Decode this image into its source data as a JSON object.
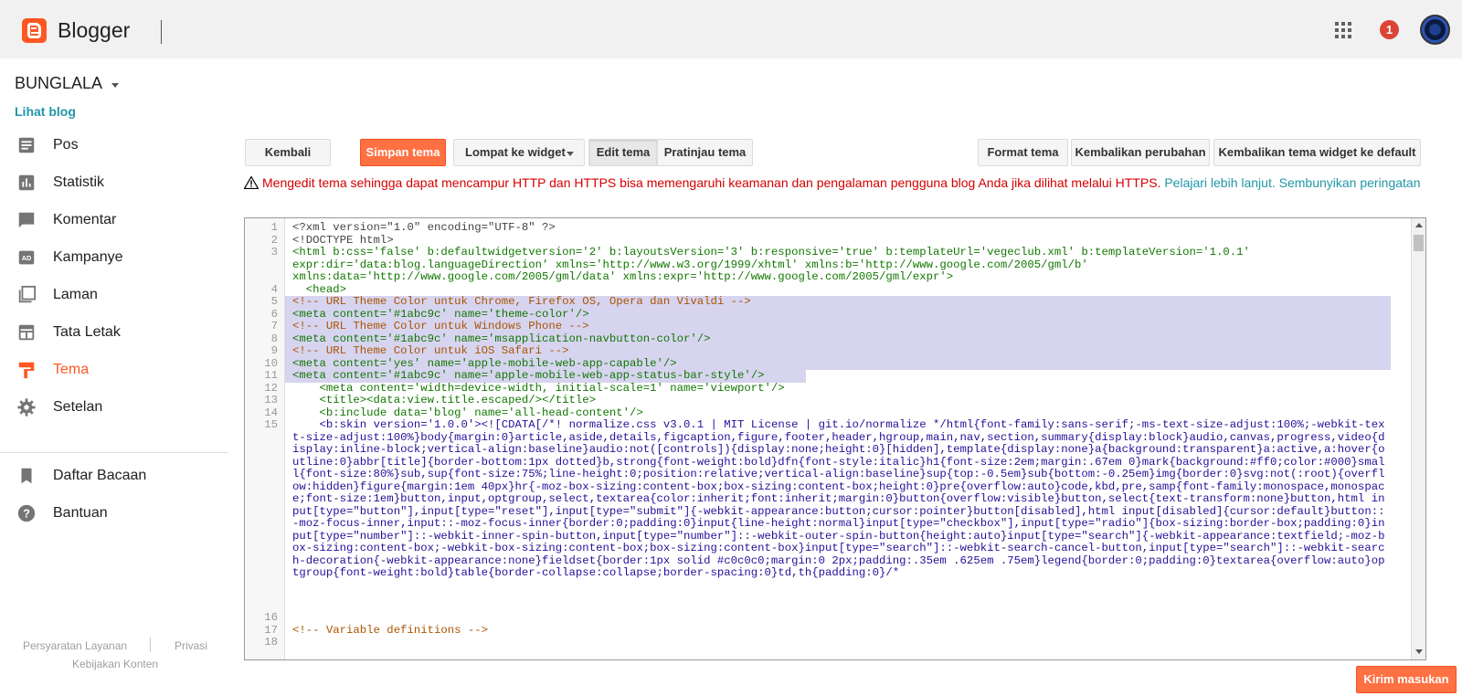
{
  "header": {
    "brand": "Blogger",
    "notification_count": "1"
  },
  "sidebar": {
    "blog_name": "BUNGLALA",
    "view_blog": "Lihat blog",
    "items": [
      {
        "label": "Pos",
        "icon": "posts-icon"
      },
      {
        "label": "Statistik",
        "icon": "stats-icon"
      },
      {
        "label": "Komentar",
        "icon": "comment-icon"
      },
      {
        "label": "Kampanye",
        "icon": "ads-icon"
      },
      {
        "label": "Laman",
        "icon": "pages-icon"
      },
      {
        "label": "Tata Letak",
        "icon": "layout-icon"
      },
      {
        "label": "Tema",
        "icon": "theme-icon",
        "active": true
      },
      {
        "label": "Setelan",
        "icon": "gear-icon"
      }
    ],
    "secondary": [
      {
        "label": "Daftar Bacaan",
        "icon": "bookmark-icon"
      },
      {
        "label": "Bantuan",
        "icon": "help-icon"
      }
    ],
    "footer": {
      "terms": "Persyaratan Layanan",
      "privacy": "Privasi",
      "content_policy": "Kebijakan Konten"
    }
  },
  "toolbar": {
    "back": "Kembali",
    "save": "Simpan tema",
    "jump_widget": "Lompat ke widget",
    "edit_theme": "Edit tema",
    "preview_theme": "Pratinjau tema",
    "format_theme": "Format tema",
    "revert_changes": "Kembalikan perubahan",
    "revert_widget": "Kembalikan tema widget ke default"
  },
  "warning": {
    "text": "Mengedit tema sehingga dapat mencampur HTTP dan HTTPS bisa memengaruhi keamanan dan pengalaman pengguna blog Anda jika dilihat melalui HTTPS.",
    "learn_more": "Pelajari lebih lanjut.",
    "hide": "Sembunyikan peringatan"
  },
  "editor": {
    "line_numbers": [
      "1",
      "2",
      "3",
      "4",
      "5",
      "6",
      "7",
      "8",
      "9",
      "10",
      "11",
      "12",
      "13",
      "14",
      "15",
      "16",
      "17",
      "18"
    ],
    "lines": {
      "l1": "<?xml version=\"1.0\" encoding=\"UTF-8\" ?>",
      "l2": "<!DOCTYPE html>",
      "l3a": "<html b:css='false' b:defaultwidgetversion='2' b:layoutsVersion='3' b:responsive='true' b:templateUrl='vegeclub.xml' b:templateVersion='1.0.1'",
      "l3b": "expr:dir='data:blog.languageDirection' xmlns='http://www.w3.org/1999/xhtml' xmlns:b='http://www.google.com/2005/gml/b'",
      "l3c": "xmlns:data='http://www.google.com/2005/gml/data' xmlns:expr='http://www.google.com/2005/gml/expr'>",
      "l4": "  <head>",
      "l5": "<!-- URL Theme Color untuk Chrome, Firefox OS, Opera dan Vivaldi -->",
      "l6": "<meta content='#1abc9c' name='theme-color'/>",
      "l7": "<!-- URL Theme Color untuk Windows Phone -->",
      "l8": "<meta content='#1abc9c' name='msapplication-navbutton-color'/>",
      "l9": "<!-- URL Theme Color untuk iOS Safari -->",
      "l10": "<meta content='yes' name='apple-mobile-web-app-capable'/>",
      "l11": "<meta content='#1abc9c' name='apple-mobile-web-app-status-bar-style'/>",
      "l12": "    <meta content='width=device-width, initial-scale=1' name='viewport'/>",
      "l13": "    <title><data:view.title.escaped/></title>",
      "l14": "    <b:include data='blog' name='all-head-content'/>",
      "l15": "    <b:skin version='1.0.0'><![CDATA[/*! normalize.css v3.0.1 | MIT License | git.io/normalize */html{font-family:sans-serif;-ms-text-size-adjust:100%;-webkit-text-size-adjust:100%}body{margin:0}article,aside,details,figcaption,figure,footer,header,hgroup,main,nav,section,summary{display:block}audio,canvas,progress,video{display:inline-block;vertical-align:baseline}audio:not([controls]){display:none;height:0}[hidden],template{display:none}a{background:transparent}a:active,a:hover{outline:0}abbr[title]{border-bottom:1px dotted}b,strong{font-weight:bold}dfn{font-style:italic}h1{font-size:2em;margin:.67em 0}mark{background:#ff0;color:#000}small{font-size:80%}sub,sup{font-size:75%;line-height:0;position:relative;vertical-align:baseline}sup{top:-0.5em}sub{bottom:-0.25em}img{border:0}svg:not(:root){overflow:hidden}figure{margin:1em 40px}hr{-moz-box-sizing:content-box;box-sizing:content-box;height:0}pre{overflow:auto}code,kbd,pre,samp{font-family:monospace,monospace;font-size:1em}button,input,optgroup,select,textarea{color:inherit;font:inherit;margin:0}button{overflow:visible}button,select{text-transform:none}button,html input[type=\"button\"],input[type=\"reset\"],input[type=\"submit\"]{-webkit-appearance:button;cursor:pointer}button[disabled],html input[disabled]{cursor:default}button::-moz-focus-inner,input::-moz-focus-inner{border:0;padding:0}input{line-height:normal}input[type=\"checkbox\"],input[type=\"radio\"]{box-sizing:border-box;padding:0}input[type=\"number\"]::-webkit-inner-spin-button,input[type=\"number\"]::-webkit-outer-spin-button{height:auto}input[type=\"search\"]{-webkit-appearance:textfield;-moz-box-sizing:content-box;-webkit-box-sizing:content-box;box-sizing:content-box}input[type=\"search\"]::-webkit-search-cancel-button,input[type=\"search\"]::-webkit-search-decoration{-webkit-appearance:none}fieldset{border:1px solid #c0c0c0;margin:0 2px;padding:.35em .625em .75em}legend{border:0;padding:0}textarea{overflow:auto}optgroup{font-weight:bold}table{border-collapse:collapse;border-spacing:0}td,th{padding:0}/*",
      "l16": "",
      "l17": "<!-- Variable definitions -->",
      "l18": ""
    }
  },
  "feedback": "Kirim masukan",
  "colors": {
    "accent": "#ff5722",
    "link": "#2196a7",
    "warning": "#d50000",
    "selection": "#d7d4f0"
  }
}
